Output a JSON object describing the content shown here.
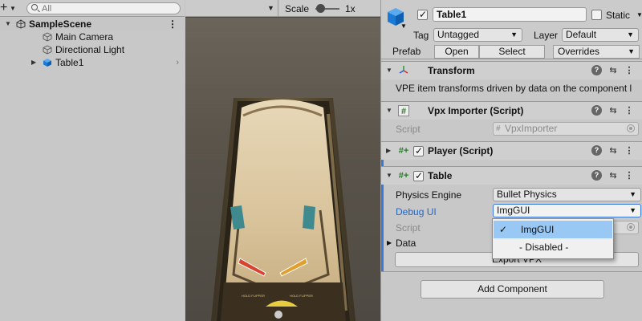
{
  "hierarchy": {
    "search_placeholder": "All",
    "scene_name": "SampleScene",
    "items": [
      {
        "label": "Main Camera"
      },
      {
        "label": "Directional Light"
      },
      {
        "label": "Table1"
      }
    ]
  },
  "scene_view": {
    "scale_label": "Scale",
    "scale_value": "1x"
  },
  "inspector": {
    "object_name": "Table1",
    "static_label": "Static",
    "tag_label": "Tag",
    "tag_value": "Untagged",
    "layer_label": "Layer",
    "layer_value": "Default",
    "prefab_label": "Prefab",
    "open_label": "Open",
    "select_label": "Select",
    "overrides_label": "Overrides",
    "components": {
      "transform": {
        "title": "Transform",
        "note": "VPE item transforms driven by data on the component l"
      },
      "vpx_importer": {
        "title": "Vpx Importer (Script)",
        "script_label": "Script",
        "script_value": "VpxImporter"
      },
      "player": {
        "title": "Player (Script)"
      },
      "table": {
        "title": "Table",
        "physics_engine_label": "Physics Engine",
        "physics_engine_value": "Bullet Physics",
        "debug_ui_label": "Debug UI",
        "debug_ui_value": "ImgGUI",
        "script_label": "Script",
        "data_label": "Data",
        "export_label": "Export VPX"
      }
    },
    "add_component_label": "Add Component",
    "debug_ui_options": [
      "ImgGUI",
      "- Disabled -"
    ]
  },
  "colors": {
    "accent_blue": "#2866c2",
    "selection_highlight": "#99c8f5",
    "unity_cube_blue": "#1a7ad6"
  }
}
